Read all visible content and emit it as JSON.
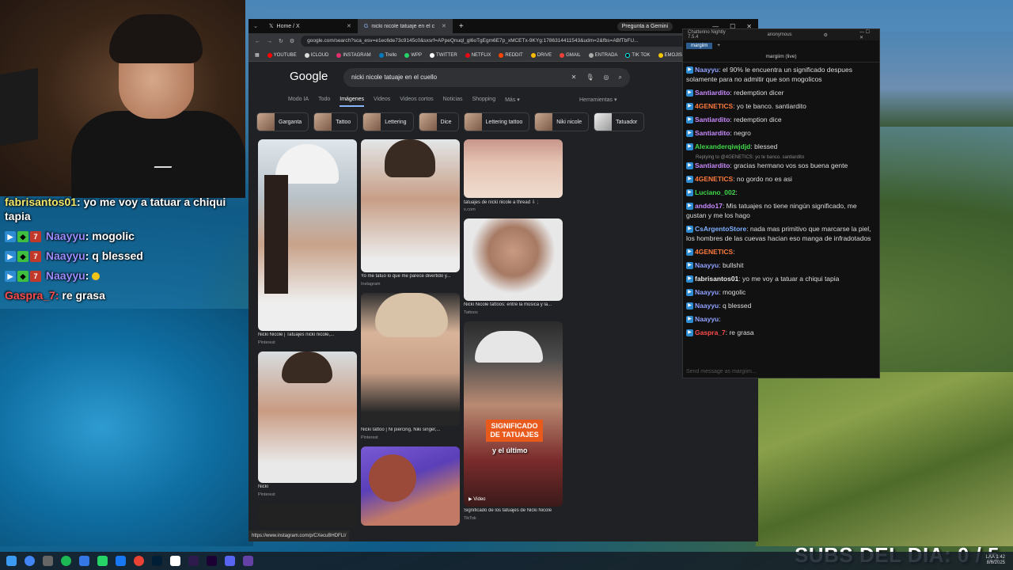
{
  "overlay_chat": [
    {
      "user": "fabrisantos01",
      "text": ": yo me voy a tatuar a chiqui tapia"
    },
    {
      "user": "Naayyu",
      "text": ": mogolic"
    },
    {
      "user": "Naayyu",
      "text": ": q blessed"
    },
    {
      "user": "Naayyu",
      "text": ":"
    },
    {
      "user": "Gaspra_7:",
      "text": " re grasa"
    }
  ],
  "browser": {
    "tabs": [
      {
        "label": "Home / X"
      },
      {
        "label": "nicki nicole tatuaje en el cuello"
      }
    ],
    "gemini_label": "Pregunta a Gemini",
    "url": "google.com/search?sca_esv=e1ec6de73c9145c0&sxsrf=APpeQnuql_gl6oTgEgm6E7p_xMCETx-9KYg:1786314411543&udm=2&fbs=ABfTbFU...",
    "bookmarks": [
      "YOUTUBE",
      "ICLOUD",
      "INSTAGRAM",
      "Trello",
      "WPP",
      "TWITTER",
      "NETFLIX",
      "REDDIT",
      "DRIVE",
      "GMAIL",
      "ENTRADA",
      "TIK TOK",
      "EMOJIS"
    ],
    "google_logo": "Google",
    "search_query": "nicki nicole tatuaje en el cuello",
    "nav": [
      "Modo IA",
      "Todo",
      "Imágenes",
      "Videos",
      "Videos cortos",
      "Noticias",
      "Shopping",
      "Más"
    ],
    "tools": "Herramientas",
    "chips": [
      "Garganta",
      "Tattoo",
      "Lettering",
      "Dice",
      "Lettering tattoo",
      "Niki nicole",
      "Tatuador"
    ],
    "results": [
      {
        "caption": "Nicki Nicole | Tatuajes nicki nicole,...",
        "source": "Pinterest"
      },
      {
        "caption": "Yo me tatuo lo que me parece divertido y...",
        "source": "Instagram"
      },
      {
        "caption": "tatuajes de nicki nicole a thread ⇩ ;",
        "source": "x.com"
      },
      {
        "caption": "Nicki Nicole tattoos: entre la música y la...",
        "source": "Tattoos"
      },
      {
        "caption": "Nicki tattoo | Ni piercing, Niki singer,...",
        "source": "Pinterest"
      },
      {
        "caption": "Nicki",
        "source": "Pinterest"
      },
      {
        "caption": "Significado de los tatuajes de Nicki Nicole",
        "source": "TikTok"
      }
    ],
    "video_overlay_1": "SIGNIFICADO DE TATUAJES",
    "video_overlay_2": "y el último",
    "video_label": "Video",
    "status_url": "https://www.instagram.com/p/CXecuBHDFLI/"
  },
  "chatterino": {
    "title": "Chatterino Nightly 7.5.4",
    "account": "anonymous",
    "tab": "margiim",
    "channel": "margiim (live)",
    "input_placeholder": "Send message as margiim...",
    "messages": [
      {
        "user": "Naayyu",
        "text": ": el 90% le encuentra un significado despues solamente para no admitir que son mogolicos",
        "cls": "c-naa"
      },
      {
        "user": "Santiardito",
        "text": ": redemption dicer",
        "cls": "c-san"
      },
      {
        "user": "4GENETICS",
        "text": ": yo te banco. santiardito",
        "cls": "c-gen"
      },
      {
        "user": "Santiardito",
        "text": ": redemption dice",
        "cls": "c-san"
      },
      {
        "user": "Santiardito",
        "text": ": negro",
        "cls": "c-san"
      },
      {
        "user": "Alexanderqiwjdjd",
        "text": ": blessed",
        "cls": "c-ale"
      },
      {
        "user": "Santiardito",
        "text": ": gracias hermano vos sos buena gente",
        "cls": "c-san",
        "reply": "Replying to @4GENETICS: yo te banco. santiardito"
      },
      {
        "user": "4GENETICS",
        "text": ": no gordo no es asi",
        "cls": "c-gen"
      },
      {
        "user": "Luciano_002",
        "text": ":",
        "cls": "c-luc"
      },
      {
        "user": "anddo17",
        "text": ": Mis tatuajes no tiene ningún significado, me gustan y me los hago",
        "cls": "c-and"
      },
      {
        "user": "CsArgentoStore",
        "text": ": nada mas primitivo que marcarse la piel, los hombres de las cuevas hacian eso manga de infradotados",
        "cls": "c-csa"
      },
      {
        "user": "4GENETICS",
        "text": ":",
        "cls": "c-gen"
      },
      {
        "user": "Naayyu",
        "text": ": bullshit",
        "cls": "c-naa"
      },
      {
        "user": "fabrisantos01",
        "text": ": yo me voy a tatuar a chiqui tapia",
        "cls": "c-fab"
      },
      {
        "user": "Naayyu",
        "text": ": mogolic",
        "cls": "c-naa"
      },
      {
        "user": "Naayyu",
        "text": ": q blessed",
        "cls": "c-naa"
      },
      {
        "user": "Naayyu",
        "text": ":",
        "cls": "c-naa"
      },
      {
        "user": "Gaspra_7",
        "text": ": re grasa",
        "cls": "c-gas"
      }
    ]
  },
  "subs_counter": "SUBS DEL DIA: 0 / 5",
  "taskbar": {
    "time": "1:42",
    "date": "8/6/2025",
    "lang": "LAA"
  }
}
